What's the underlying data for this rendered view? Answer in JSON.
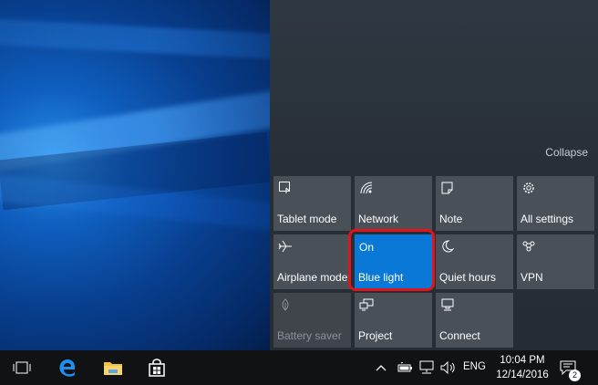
{
  "action_center": {
    "collapse_label": "Collapse",
    "tiles": [
      {
        "label": "Tablet mode",
        "icon": "tablet-mode-icon"
      },
      {
        "label": "Network",
        "icon": "network-icon"
      },
      {
        "label": "Note",
        "icon": "note-icon"
      },
      {
        "label": "All settings",
        "icon": "gear-icon"
      },
      {
        "label": "Airplane mode",
        "icon": "airplane-icon"
      },
      {
        "label": "Blue light",
        "state": "On",
        "icon": "blue-light-icon",
        "active": true
      },
      {
        "label": "Quiet hours",
        "icon": "moon-icon"
      },
      {
        "label": "VPN",
        "icon": "vpn-icon"
      },
      {
        "label": "Battery saver",
        "icon": "battery-saver-icon",
        "disabled": true
      },
      {
        "label": "Project",
        "icon": "project-icon"
      },
      {
        "label": "Connect",
        "icon": "connect-icon"
      }
    ],
    "accent_color": "#0a78d7",
    "highlight_color": "#e0141a"
  },
  "taskbar": {
    "pinned": [
      "task-view-icon",
      "edge-icon",
      "file-explorer-icon",
      "store-icon"
    ],
    "tray_icons": [
      "chevron-up-icon",
      "battery-icon",
      "network-tray-icon",
      "volume-icon"
    ],
    "language": "ENG",
    "time": "10:04 PM",
    "date": "12/14/2016",
    "notification_count": "2"
  }
}
